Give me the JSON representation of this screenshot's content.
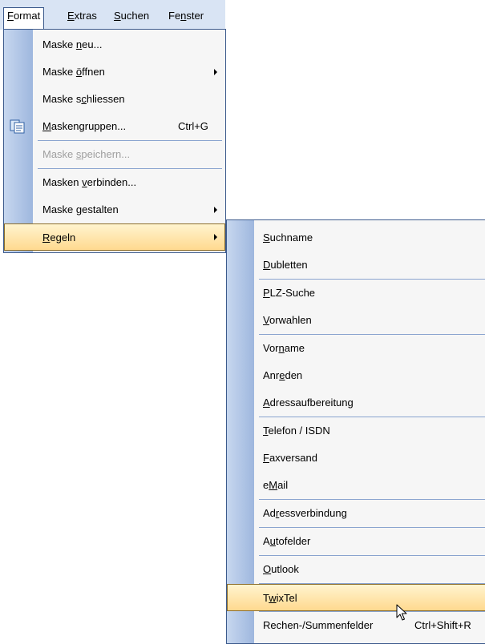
{
  "menubar": {
    "items": [
      {
        "pre": "",
        "mn": "F",
        "post": "ormat"
      },
      {
        "pre": "",
        "mn": "E",
        "post": "xtras"
      },
      {
        "pre": "",
        "mn": "S",
        "post": "uchen"
      },
      {
        "pre": "Fe",
        "mn": "n",
        "post": "ster"
      }
    ]
  },
  "format_menu": {
    "items": [
      {
        "pre": "Maske ",
        "mn": "n",
        "post": "eu..."
      },
      {
        "pre": "Maske ",
        "mn": "ö",
        "post": "ffnen"
      },
      {
        "pre": "Maske s",
        "mn": "c",
        "post": "hliessen"
      },
      {
        "pre": "",
        "mn": "M",
        "post": "askengruppen...",
        "shortcut": "Ctrl+G"
      },
      {
        "pre": "Maske ",
        "mn": "s",
        "post": "peichern..."
      },
      {
        "pre": "Masken ",
        "mn": "v",
        "post": "erbinden..."
      },
      {
        "pre": "Maske ",
        "mn": "g",
        "post": "estalten"
      },
      {
        "pre": "",
        "mn": "R",
        "post": "egeln"
      }
    ]
  },
  "regeln_menu": {
    "items": [
      {
        "pre": "",
        "mn": "S",
        "post": "uchname"
      },
      {
        "pre": "",
        "mn": "D",
        "post": "ubletten"
      },
      {
        "pre": "",
        "mn": "P",
        "post": "LZ-Suche"
      },
      {
        "pre": "",
        "mn": "V",
        "post": "orwahlen"
      },
      {
        "pre": "Vor",
        "mn": "n",
        "post": "ame"
      },
      {
        "pre": "Anr",
        "mn": "e",
        "post": "den"
      },
      {
        "pre": "",
        "mn": "A",
        "post": "dressaufbereitung"
      },
      {
        "pre": "",
        "mn": "T",
        "post": "elefon / ISDN"
      },
      {
        "pre": "",
        "mn": "F",
        "post": "axversand"
      },
      {
        "pre": "e",
        "mn": "M",
        "post": "ail"
      },
      {
        "pre": "Ad",
        "mn": "r",
        "post": "essverbindung"
      },
      {
        "pre": "A",
        "mn": "u",
        "post": "tofelder"
      },
      {
        "pre": "",
        "mn": "O",
        "post": "utlook"
      },
      {
        "pre": "T",
        "mn": "w",
        "post": "ixTel"
      },
      {
        "pre": "Rechen-/Summenfelder",
        "mn": "",
        "post": "",
        "shortcut": "Ctrl+Shift+R"
      }
    ]
  },
  "colors": {
    "menubar_bg": "#d9e4f4",
    "menu_bg": "#f6f6f6",
    "border": "#3c5a8c",
    "highlight_top": "#fff4cf",
    "highlight_bottom": "#ffd98f",
    "disabled_text": "#a0a0a0"
  },
  "icons": {
    "maskengruppen": "mask-group-icon",
    "submenu": "submenu-arrow-icon",
    "pointer": "mouse-pointer-icon"
  }
}
